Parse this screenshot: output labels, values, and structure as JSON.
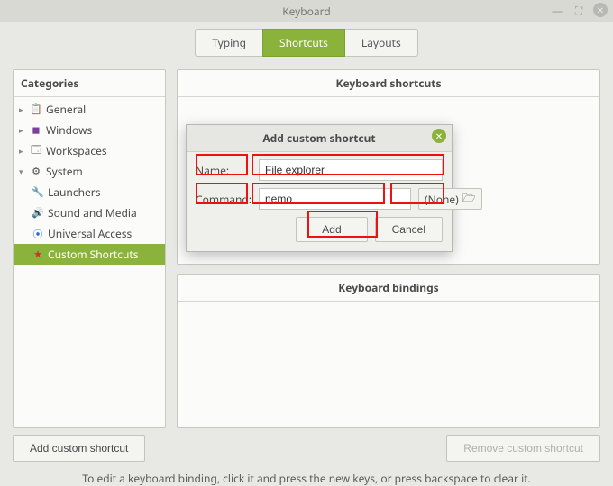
{
  "window": {
    "title": "Keyboard"
  },
  "tabs": [
    {
      "label": "Typing",
      "active": false
    },
    {
      "label": "Shortcuts",
      "active": true
    },
    {
      "label": "Layouts",
      "active": false
    }
  ],
  "sidebar": {
    "header": "Categories",
    "items": [
      {
        "label": "General",
        "icon": "📋",
        "expandable": true
      },
      {
        "label": "Windows",
        "icon": "🟪",
        "expandable": true
      },
      {
        "label": "Workspaces",
        "icon": "🗔",
        "expandable": true
      },
      {
        "label": "System",
        "icon": "⚙",
        "expandable": true,
        "expanded": true,
        "children": [
          {
            "label": "Launchers",
            "icon": "🚀"
          },
          {
            "label": "Sound and Media",
            "icon": "🔊"
          },
          {
            "label": "Universal Access",
            "icon": "♿"
          },
          {
            "label": "Custom Shortcuts",
            "icon": "★",
            "selected": true
          }
        ]
      }
    ]
  },
  "content": {
    "shortcuts_header": "Keyboard shortcuts",
    "bindings_header": "Keyboard bindings"
  },
  "buttons": {
    "add_custom": "Add custom shortcut",
    "remove_custom": "Remove custom shortcut"
  },
  "footer": "To edit a keyboard binding, click it and press the new keys, or press backspace to clear it.",
  "dialog": {
    "title": "Add custom shortcut",
    "name_label": "Name:",
    "name_value": "File explorer",
    "command_label": "Command:",
    "command_value": "nemo",
    "none_label": "(None)",
    "add_label": "Add",
    "cancel_label": "Cancel"
  }
}
